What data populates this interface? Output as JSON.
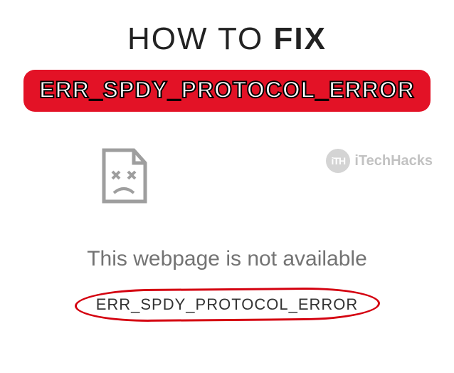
{
  "headline": {
    "part1": "HOW TO ",
    "part2": "FIX"
  },
  "badge": {
    "label": "ERR_SPDY_PROTOCOL_ERROR"
  },
  "watermark": {
    "logo_text": "iTH",
    "brand": "iTechHacks"
  },
  "error": {
    "message": "This webpage is not available",
    "code": "ERR_SPDY_PROTOCOL_ERROR"
  },
  "colors": {
    "accent": "#e31226",
    "annotation": "#d4000f"
  }
}
